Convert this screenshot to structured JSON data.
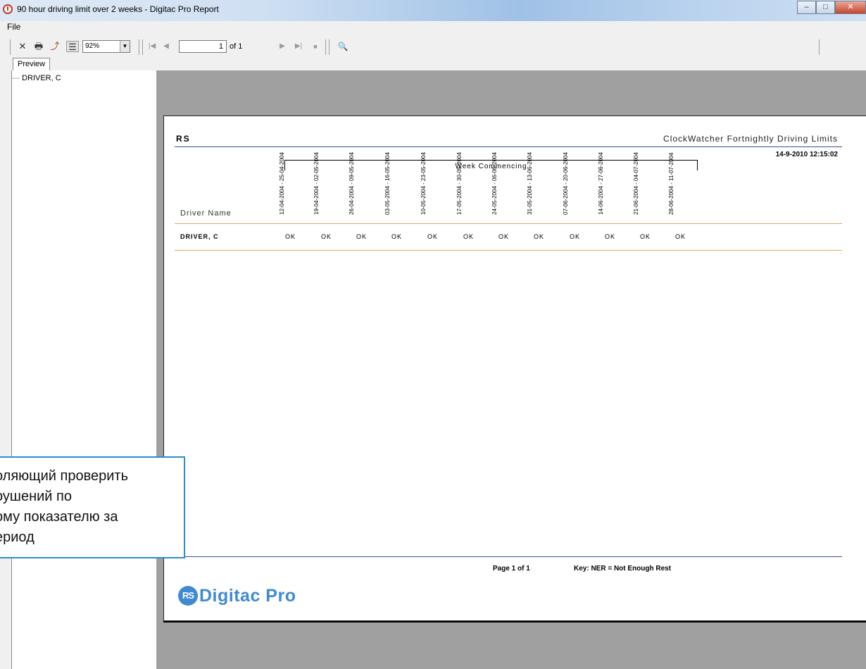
{
  "window": {
    "title": "90 hour driving limit over 2 weeks - Digitac Pro Report",
    "minimize": "–",
    "maximize": "□",
    "close": "✕"
  },
  "menu": {
    "file": "File"
  },
  "toolbar": {
    "close_icon": "✕",
    "print_icon": "🖶",
    "export_icon": "⤴",
    "tree_icon": "☰",
    "zoom": "92%",
    "dropdown": "▼",
    "first": "|◀",
    "prev": "◀",
    "page_value": "1",
    "page_of": "of 1",
    "next": "▶",
    "last": "▶|",
    "stop": "■",
    "find": "🔍"
  },
  "tabs": {
    "preview": "Preview"
  },
  "tree": {
    "item": "DRIVER, C",
    "line": "—"
  },
  "report": {
    "company": "RS",
    "title": "ClockWatcher Fortnightly Driving Limits",
    "datetime": "14-9-2010  12:15:02",
    "week_label": "Week Commencing",
    "driver_header": "Driver Name",
    "weeks": [
      "12-04-2004 - 25-04-2004",
      "19-04-2004 - 02-05-2004",
      "26-04-2004 - 09-05-2004",
      "03-05-2004 - 16-05-2004",
      "10-05-2004 - 23-05-2004",
      "17-05-2004 - 30-05-2004",
      "24-05-2004 - 06-06-2004",
      "31-05-2004 - 13-06-2004",
      "07-06-2004 - 20-06-2004",
      "14-06-2004 - 27-06-2004",
      "21-06-2004 - 04-07-2004",
      "28-06-2004 - 11-07-2004"
    ],
    "rows": [
      {
        "driver": "DRIVER, C",
        "values": [
          "OK",
          "OK",
          "OK",
          "OK",
          "OK",
          "OK",
          "OK",
          "OK",
          "OK",
          "OK",
          "OK",
          "OK"
        ]
      }
    ],
    "footer_page": "Page 1 of 1",
    "footer_key": "Key: NER  = Not Enough Rest",
    "logo_mark": "RS",
    "logo_text": "Digitac Pro"
  },
  "callout": {
    "lines": [
      "оляющий проверить",
      "рушений по",
      "ому показателю за",
      "ериод"
    ]
  }
}
